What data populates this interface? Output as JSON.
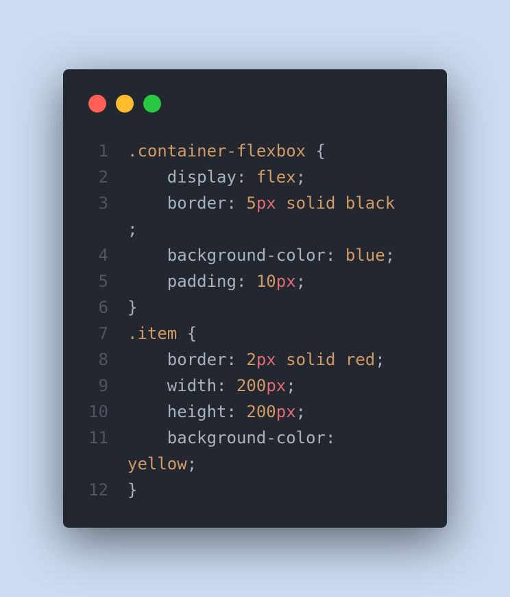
{
  "window": {
    "traffic_lights": [
      {
        "name": "close",
        "color": "#ff5f57"
      },
      {
        "name": "minimize",
        "color": "#ffbd2e"
      },
      {
        "name": "maximize",
        "color": "#28c840"
      }
    ]
  },
  "code": {
    "lines": [
      {
        "num": "1",
        "tokens": [
          {
            "t": ".container-flexbox",
            "c": "sel"
          },
          {
            "t": " {",
            "c": "punc"
          }
        ]
      },
      {
        "num": "2",
        "tokens": [
          {
            "t": "    display",
            "c": "prop"
          },
          {
            "t": ": ",
            "c": "punc"
          },
          {
            "t": "flex",
            "c": "val"
          },
          {
            "t": ";",
            "c": "punc"
          }
        ]
      },
      {
        "num": "3",
        "tokens": [
          {
            "t": "    border",
            "c": "prop"
          },
          {
            "t": ": ",
            "c": "punc"
          },
          {
            "t": "5",
            "c": "val"
          },
          {
            "t": "px",
            "c": "unit"
          },
          {
            "t": " solid black",
            "c": "val"
          }
        ]
      },
      {
        "num": "",
        "tokens": [
          {
            "t": ";",
            "c": "punc"
          }
        ]
      },
      {
        "num": "4",
        "tokens": [
          {
            "t": "    background-color",
            "c": "prop"
          },
          {
            "t": ": ",
            "c": "punc"
          },
          {
            "t": "blue",
            "c": "val"
          },
          {
            "t": ";",
            "c": "punc"
          }
        ]
      },
      {
        "num": "5",
        "tokens": [
          {
            "t": "    padding",
            "c": "prop"
          },
          {
            "t": ": ",
            "c": "punc"
          },
          {
            "t": "10",
            "c": "val"
          },
          {
            "t": "px",
            "c": "unit"
          },
          {
            "t": ";",
            "c": "punc"
          }
        ]
      },
      {
        "num": "6",
        "tokens": [
          {
            "t": "}",
            "c": "punc"
          }
        ]
      },
      {
        "num": "7",
        "tokens": [
          {
            "t": ".item",
            "c": "sel"
          },
          {
            "t": " {",
            "c": "punc"
          }
        ]
      },
      {
        "num": "8",
        "tokens": [
          {
            "t": "    border",
            "c": "prop"
          },
          {
            "t": ": ",
            "c": "punc"
          },
          {
            "t": "2",
            "c": "val"
          },
          {
            "t": "px",
            "c": "unit"
          },
          {
            "t": " solid red",
            "c": "val"
          },
          {
            "t": ";",
            "c": "punc"
          }
        ]
      },
      {
        "num": "9",
        "tokens": [
          {
            "t": "    width",
            "c": "prop"
          },
          {
            "t": ": ",
            "c": "punc"
          },
          {
            "t": "200",
            "c": "val"
          },
          {
            "t": "px",
            "c": "unit"
          },
          {
            "t": ";",
            "c": "punc"
          }
        ]
      },
      {
        "num": "10",
        "tokens": [
          {
            "t": "    height",
            "c": "prop"
          },
          {
            "t": ": ",
            "c": "punc"
          },
          {
            "t": "200",
            "c": "val"
          },
          {
            "t": "px",
            "c": "unit"
          },
          {
            "t": ";",
            "c": "punc"
          }
        ]
      },
      {
        "num": "11",
        "tokens": [
          {
            "t": "    background-color",
            "c": "prop"
          },
          {
            "t": ":",
            "c": "punc"
          }
        ]
      },
      {
        "num": "",
        "tokens": [
          {
            "t": "yellow",
            "c": "val"
          },
          {
            "t": ";",
            "c": "punc"
          }
        ]
      },
      {
        "num": "12",
        "tokens": [
          {
            "t": "}",
            "c": "punc"
          }
        ]
      }
    ]
  }
}
